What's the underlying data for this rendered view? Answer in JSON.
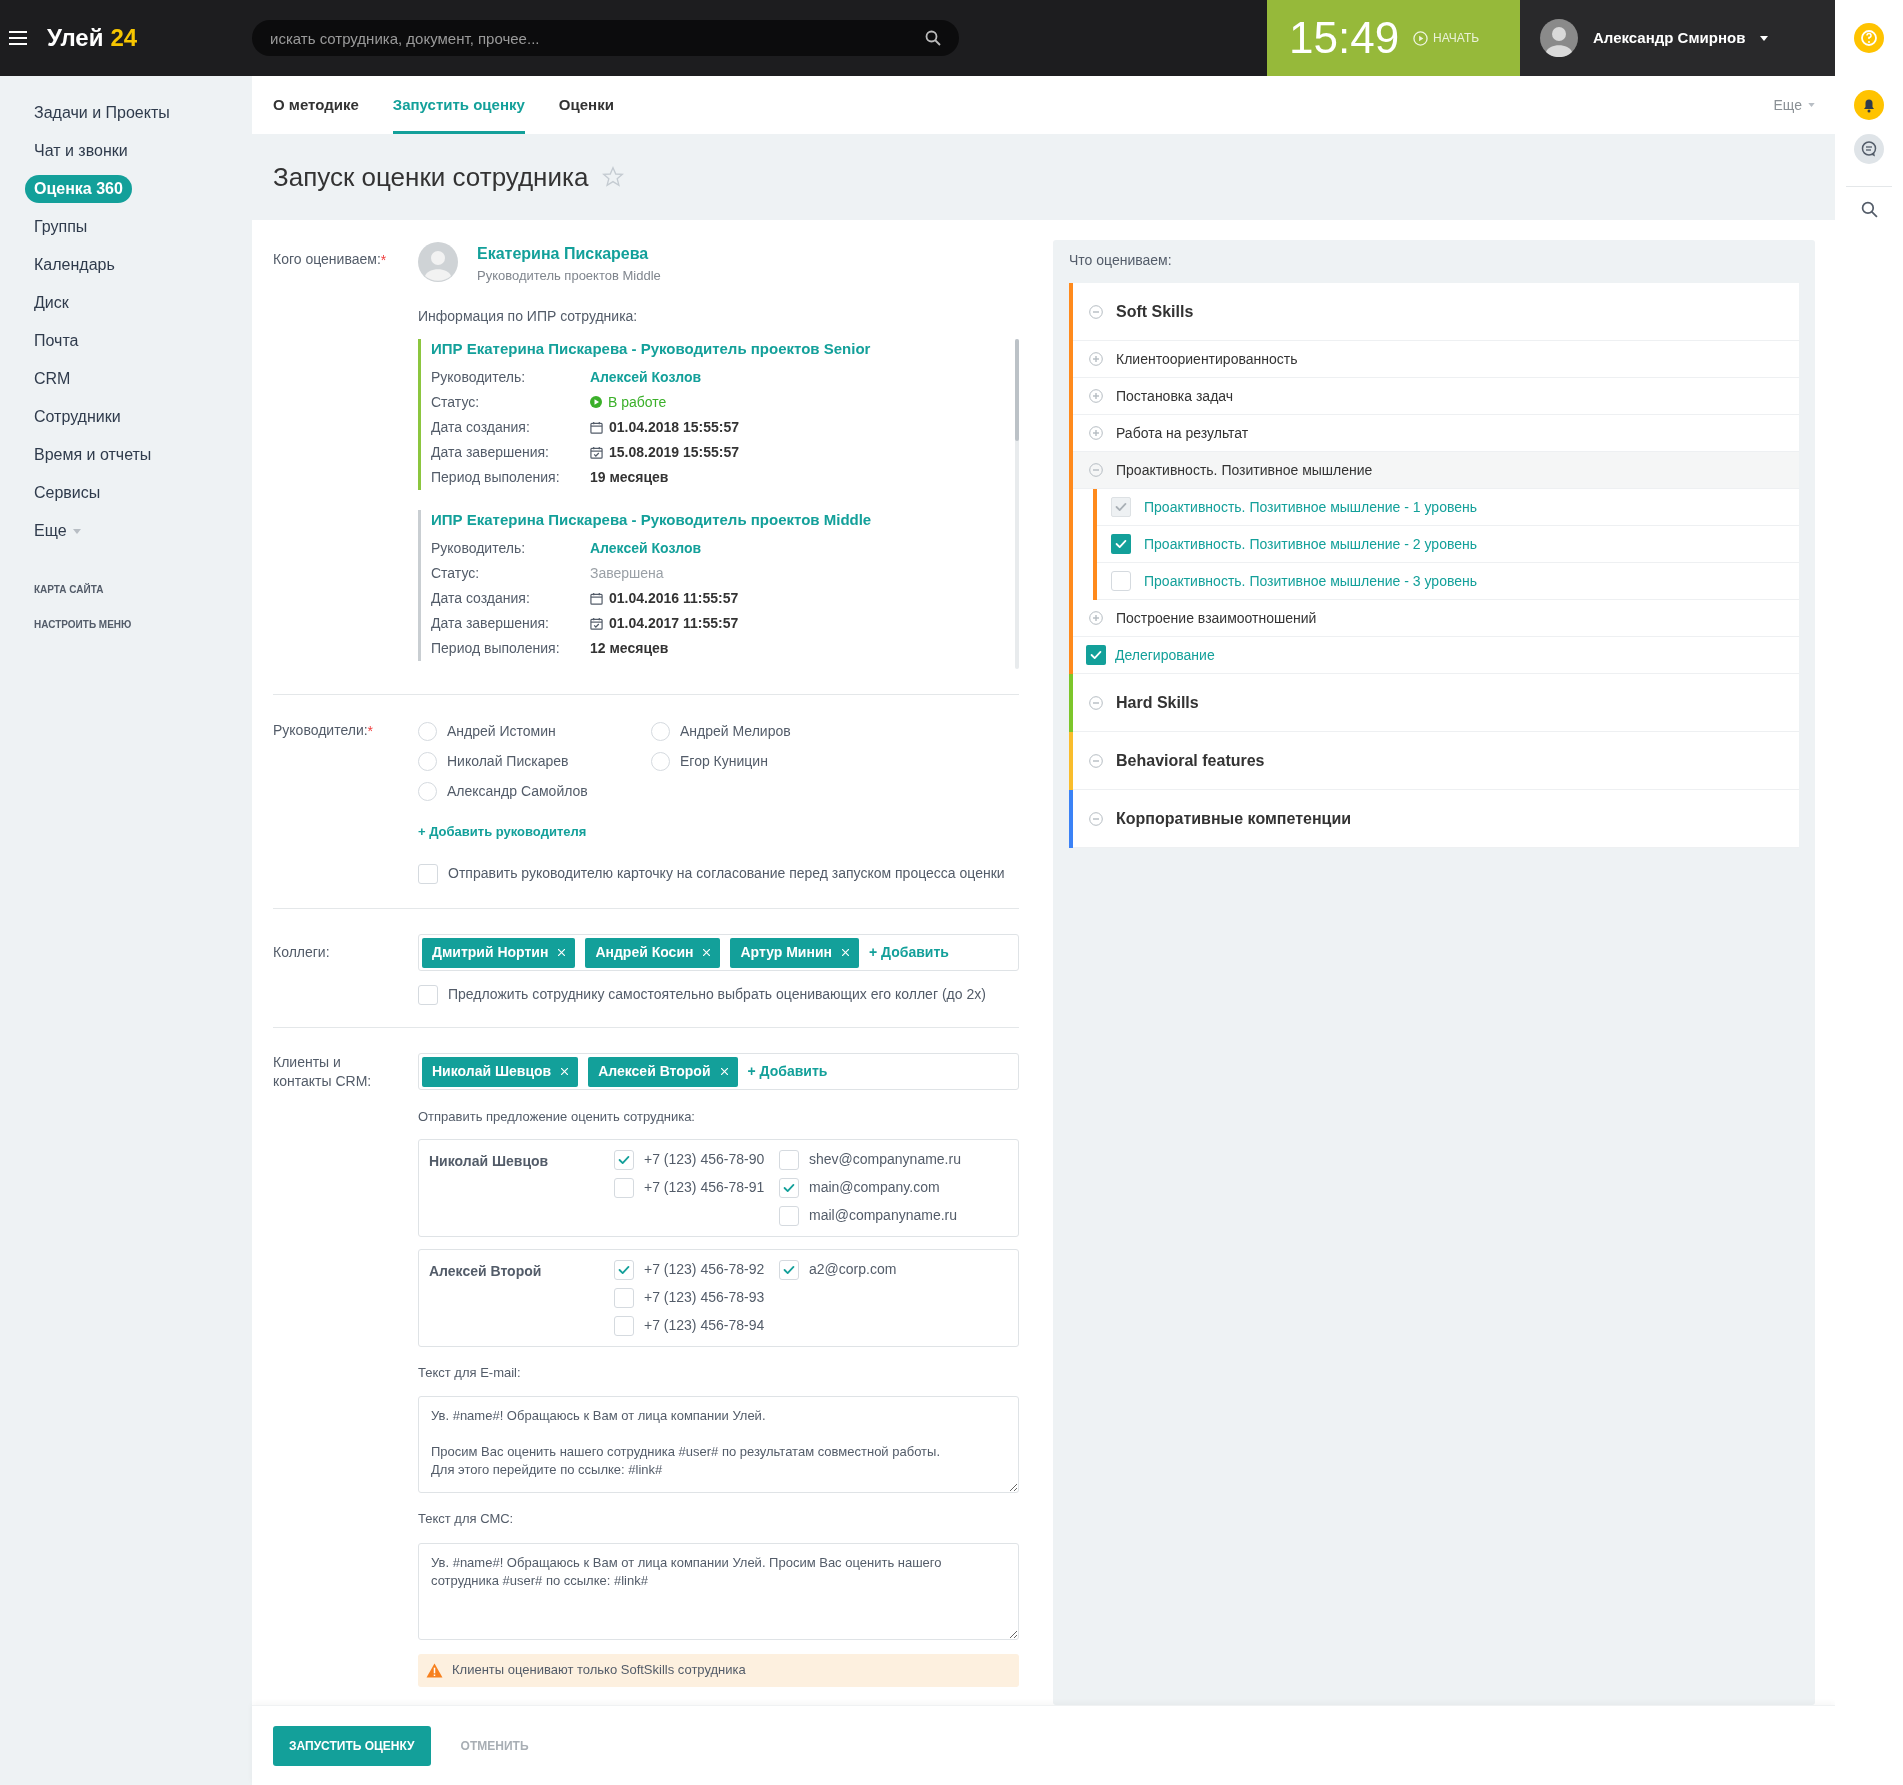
{
  "header": {
    "logo_text": "Улей",
    "logo_number": "24",
    "search_placeholder": "искать сотрудника, документ, прочее...",
    "clock": "15:49",
    "start_label": "НАЧАТЬ",
    "user_name": "Александр Смирнов"
  },
  "sidebar": {
    "items": [
      {
        "label": "Задачи и Проекты",
        "selected": false
      },
      {
        "label": "Чат и звонки",
        "selected": false
      },
      {
        "label": "Оценка 360",
        "selected": true
      },
      {
        "label": "Группы",
        "selected": false
      },
      {
        "label": "Календарь",
        "selected": false
      },
      {
        "label": "Диск",
        "selected": false
      },
      {
        "label": "Почта",
        "selected": false
      },
      {
        "label": "CRM",
        "selected": false
      },
      {
        "label": "Сотрудники",
        "selected": false
      },
      {
        "label": "Время и отчеты",
        "selected": false
      },
      {
        "label": "Сервисы",
        "selected": false
      }
    ],
    "more": "Еще",
    "links": [
      "КАРТА САЙТА",
      "НАСТРОИТЬ МЕНЮ"
    ]
  },
  "tabs": [
    {
      "label": "О методике",
      "selected": false
    },
    {
      "label": "Запустить оценку",
      "selected": true
    },
    {
      "label": "Оценки",
      "selected": false
    }
  ],
  "tabs_more": "Еще",
  "page_title": "Запуск оценки сотрудника",
  "form": {
    "employee_label": "Кого оцениваем:",
    "employee_required_mark": "*",
    "employee_name": "Екатерина Пискарева",
    "employee_position": "Руководитель проектов Middle",
    "ipr_title": "Информация по ИПР сотрудника:",
    "ipr": [
      {
        "title": "ИПР Екатерина Пискарева - Руководитель проектов Senior",
        "active": true,
        "fields": [
          {
            "label": "Руководитель:",
            "value": "Алексей Козлов",
            "kind": "link"
          },
          {
            "label": "Статус:",
            "value": "В работе",
            "kind": "status_active"
          },
          {
            "label": "Дата создания:",
            "value": "01.04.2018 15:55:57",
            "kind": "date"
          },
          {
            "label": "Дата завершения:",
            "value": "15.08.2019 15:55:57",
            "kind": "date_end"
          },
          {
            "label": "Период выполения:",
            "value": "19 месяцев",
            "kind": "bold"
          }
        ]
      },
      {
        "title": "ИПР Екатерина Пискарева - Руководитель проектов Middle",
        "active": false,
        "fields": [
          {
            "label": "Руководитель:",
            "value": "Алексей Козлов",
            "kind": "link"
          },
          {
            "label": "Статус:",
            "value": "Завершена",
            "kind": "status_done"
          },
          {
            "label": "Дата создания:",
            "value": "01.04.2016 11:55:57",
            "kind": "date"
          },
          {
            "label": "Дата завершения:",
            "value": "01.04.2017 11:55:57",
            "kind": "date_end"
          },
          {
            "label": "Период выполения:",
            "value": "12 месяцев",
            "kind": "bold"
          }
        ]
      }
    ],
    "managers_label": "Руководители:",
    "managers_required_mark": "*",
    "managers": [
      {
        "label": "Андрей Истомин",
        "selected": false
      },
      {
        "label": "Андрей Мелиров",
        "selected": false
      },
      {
        "label": "Николай Пискарев",
        "selected": false
      },
      {
        "label": "Егор Куницин",
        "selected": false
      },
      {
        "label": "Александр Самойлов",
        "selected": false
      }
    ],
    "add_manager": "+ Добавить руководителя",
    "approval": {
      "label": "Отправить руководителю карточку на согласование перед запуском процесса оценки",
      "checked": false
    },
    "colleagues_label": "Коллеги:",
    "colleagues": [
      "Дмитрий Нортин",
      "Андрей Косин",
      "Артур Минин"
    ],
    "colleagues_add": "+ Добавить",
    "self_choose": {
      "label": "Предложить сотруднику самостоятельно выбрать оценивающих его коллег (до 2х)",
      "checked": false
    },
    "clients_label": "Клиенты и контакты CRM:",
    "clients": [
      "Николай Шевцов",
      "Алексей Второй"
    ],
    "clients_add": "+ Добавить",
    "send_label": "Отправить предложение оценить сотрудника:",
    "contacts": [
      {
        "name": "Николай Шевцов",
        "phones": [
          {
            "text": "+7 (123) 456-78-90",
            "checked": true
          },
          {
            "text": "+7 (123) 456-78-91",
            "checked": false
          }
        ],
        "emails": [
          {
            "text": "shev@companyname.ru",
            "checked": false
          },
          {
            "text": "main@company.com",
            "checked": true
          },
          {
            "text": "mail@companyname.ru",
            "checked": false
          }
        ]
      },
      {
        "name": "Алексей Второй",
        "phones": [
          {
            "text": "+7 (123) 456-78-92",
            "checked": true
          },
          {
            "text": "+7 (123) 456-78-93",
            "checked": false
          },
          {
            "text": "+7 (123) 456-78-94",
            "checked": false
          }
        ],
        "emails": [
          {
            "text": "a2@corp.com",
            "checked": true
          }
        ]
      }
    ],
    "email_label": "Текст для E-mail:",
    "email_text": "Ув. #name#! Обращаюсь к Вам от лица компании Улей.\n\nПросим Вас оценить нашего сотрудника #user# по результатам совместной работы.\nДля этого перейдите по ссылке: #link#",
    "sms_label": "Текст для СМС:",
    "sms_text": "Ув. #name#! Обращаюсь к Вам от лица компании Улей. Просим Вас оценить нашего сотрудника #user# по ссылке: #link#",
    "warning": "Клиенты оценивают только SoftSkills сотрудника"
  },
  "tree": {
    "title": "Что оцениваем:",
    "groups": [
      {
        "title": "Soft Skills",
        "color": "#ff8a1c",
        "expanded": true,
        "children": [
          {
            "label": "Клиентоориентированность",
            "kind": "expandable",
            "expanded": false
          },
          {
            "label": "Постановка задач",
            "kind": "expandable",
            "expanded": false
          },
          {
            "label": "Работа на результат",
            "kind": "expandable",
            "expanded": false
          },
          {
            "label": "Проактивность. Позитивное мышление",
            "kind": "expandable",
            "expanded": true,
            "children": [
              {
                "label": "Проактивность. Позитивное мышление - 1 уровень",
                "checked": true,
                "disabled": true
              },
              {
                "label": "Проактивность. Позитивное мышление - 2 уровень",
                "checked": true,
                "disabled": false
              },
              {
                "label": "Проактивность. Позитивное мышление - 3 уровень",
                "checked": false,
                "disabled": false
              }
            ]
          },
          {
            "label": "Построение взаимоотношений",
            "kind": "expandable",
            "expanded": false
          },
          {
            "label": "Делегирование",
            "kind": "checkbox",
            "checked": true
          }
        ]
      },
      {
        "title": "Hard Skills",
        "color": "#7cc62a",
        "expanded": true
      },
      {
        "title": "Behavioral features",
        "color": "#f9bd2c",
        "expanded": true
      },
      {
        "title": "Корпоративные компетенции",
        "color": "#3b82f6",
        "expanded": true
      }
    ]
  },
  "footer": {
    "submit": "ЗАПУСТИТЬ ОЦЕНКУ",
    "cancel": "ОТМЕНИТЬ"
  }
}
